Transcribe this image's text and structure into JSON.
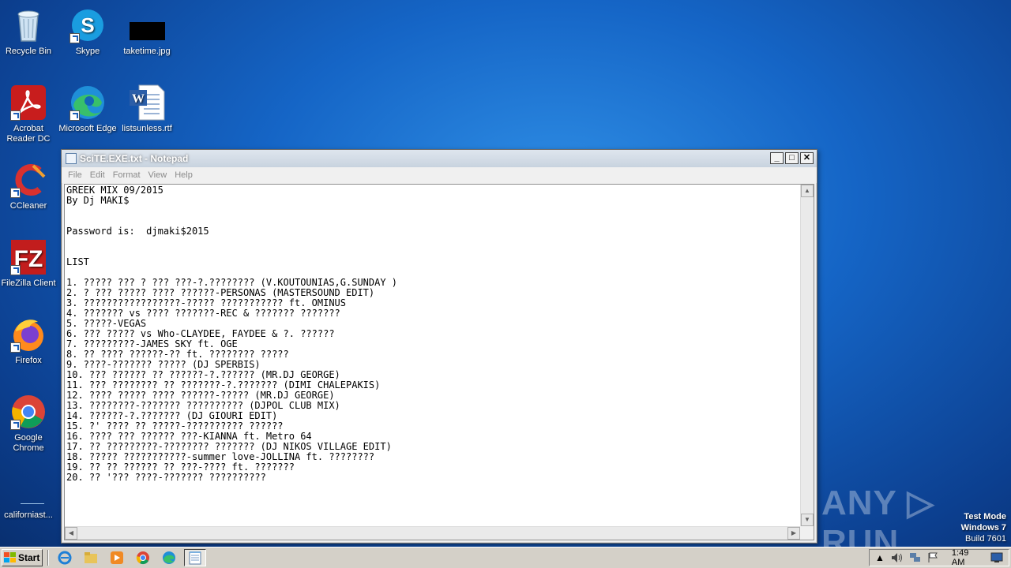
{
  "desktop": {
    "icons": [
      {
        "label": "Recycle Bin"
      },
      {
        "label": "Skype"
      },
      {
        "label": "taketime.jpg"
      },
      {
        "label": "Acrobat Reader DC"
      },
      {
        "label": "Microsoft Edge"
      },
      {
        "label": "listsunless.rtf"
      },
      {
        "label": "CCleaner"
      },
      {
        "label": "FileZilla Client"
      },
      {
        "label": "Firefox"
      },
      {
        "label": "Google Chrome"
      },
      {
        "label": "californiast..."
      }
    ]
  },
  "notepad": {
    "title": "SciTE.EXE.txt - Notepad",
    "menu": [
      "File",
      "Edit",
      "Format",
      "View",
      "Help"
    ],
    "lines": [
      "GREEK MIX 09/2015",
      "By Dj MAKI$",
      "",
      "",
      "Password is:  djmaki$2015",
      "",
      "",
      "LIST",
      "",
      "1. ????? ??? ? ??? ???-?.???????? (V.KOUTOUNIAS,G.SUNDAY )",
      "2. ? ??? ????? ???? ??????-PERSONAS (MASTERSOUND EDIT)",
      "3. ?????????????????-????? ??????????? ft. OMINUS",
      "4. ??????? vs ???? ???????-REC & ??????? ???????",
      "5. ?????-VEGAS",
      "6. ??? ????? vs Who-CLAYDEE, FAYDEE & ?. ??????",
      "7. ?????????-JAMES SKY ft. OGE",
      "8. ?? ???? ??????-?? ft. ???????? ?????",
      "9. ????-??????? ????? (DJ SPERBIS)",
      "10. ??? ?????? ?? ??????-?.?????? (MR.DJ GEORGE)",
      "11. ??? ???????? ?? ???????-?.??????? (DIMI CHALEPAKIS)",
      "12. ???? ????? ???? ??????-????? (MR.DJ GEORGE)",
      "13. ????????-??????? ?????????? (DJPOL CLUB MIX)",
      "14. ??????-?.??????? (DJ GIOURI EDIT)",
      "15. ?' ???? ?? ?????-?????????? ??????",
      "16. ???? ??? ?????? ???-KIANNA ft. Metro 64",
      "17. ?? ?????????-???????? ??????? (DJ NIKOS VILLAGE EDIT)",
      "18. ????? ???????????-summer love-JOLLINA ft. ????????",
      "19. ?? ?? ?????? ?? ???-???? ft. ???????",
      "20. ?? '??? ????-??????? ??????????"
    ]
  },
  "watermark": {
    "text": "ANY ▷ RUN"
  },
  "testmode": {
    "line1": "Test Mode",
    "line2": "Windows 7",
    "line3": "Build 7601"
  },
  "taskbar": {
    "start_label": "Start",
    "clock": "1:49 AM"
  }
}
